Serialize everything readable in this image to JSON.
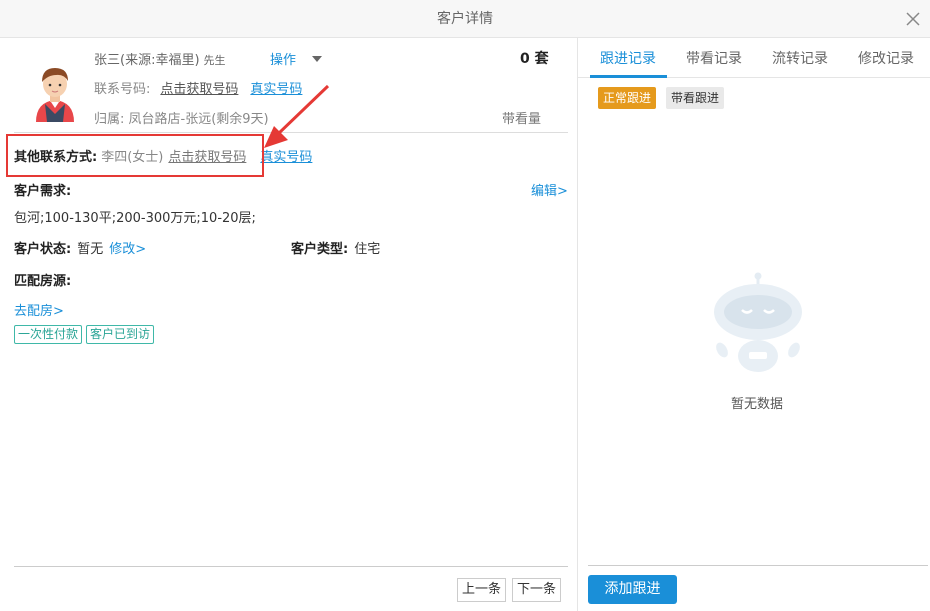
{
  "window": {
    "title": "客户详情"
  },
  "customer": {
    "name_source": "张三(来源:幸福里)",
    "gender": "先生",
    "operation_label": "操作",
    "count": "0 套",
    "phone_label": "联系号码:",
    "get_number_link": "点击获取号码",
    "real_number_link": "真实号码",
    "owner_text": "归属:  凤台路店-张远(剩余9天)",
    "view_count_label": "带看量"
  },
  "other_contact": {
    "label": "其他联系方式:",
    "value": "李四(女士)",
    "get_number_link": "点击获取号码",
    "real_number_link": "真实号码"
  },
  "requirement": {
    "label": "客户需求:",
    "edit_link": "编辑>",
    "value": "包河;100-130平;200-300万元;10-20层;"
  },
  "status": {
    "label": "客户状态:",
    "value": "暂无",
    "modify_link": "修改>"
  },
  "type": {
    "label": "客户类型:",
    "value": "住宅"
  },
  "match": {
    "label": "匹配房源:",
    "goto_link": "去配房>"
  },
  "tags": [
    "一次性付款",
    "客户已到访"
  ],
  "pager": {
    "prev": "上一条",
    "next": "下一条"
  },
  "tabs": [
    {
      "label": "跟进记录",
      "active": true
    },
    {
      "label": "带看记录",
      "active": false
    },
    {
      "label": "流转记录",
      "active": false
    },
    {
      "label": "修改记录",
      "active": false
    }
  ],
  "filters": {
    "normal": "正常跟进",
    "view": "带看跟进"
  },
  "empty_text": "暂无数据",
  "add_button": "添加跟进",
  "colors": {
    "accent": "#1a8fd8",
    "orange": "#e59a1c",
    "highlight_red": "#e53935",
    "tag_teal": "#3fb8a8"
  }
}
